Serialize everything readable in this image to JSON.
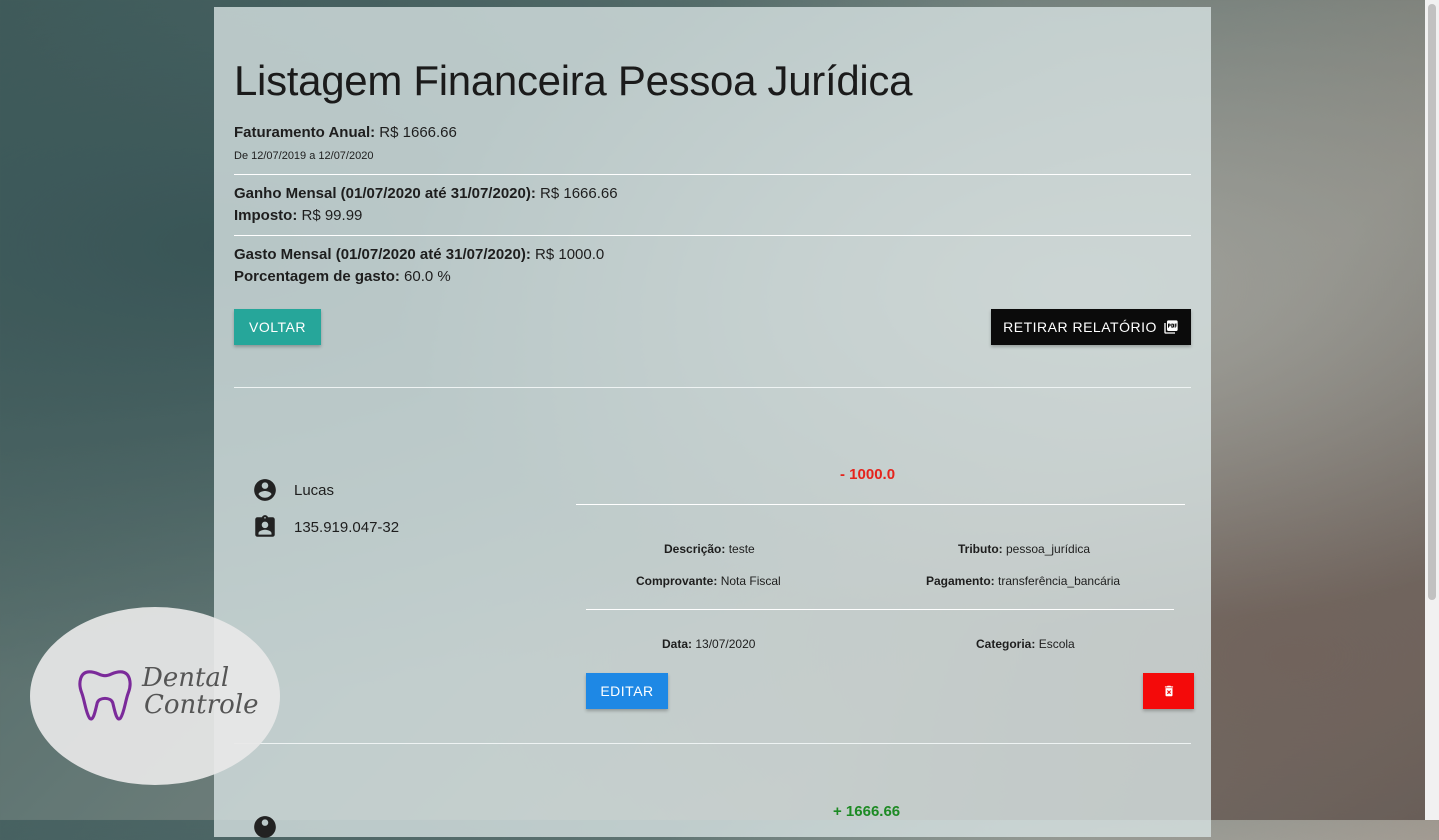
{
  "page": {
    "title": "Listagem Financeira Pessoa Jurídica"
  },
  "summary": {
    "annual_label": "Faturamento Anual:",
    "annual_value": "R$ 1666.66",
    "period_text": "De 12/07/2019 a 12/07/2020",
    "monthly_gain_label": "Ganho Mensal (01/07/2020 até 31/07/2020):",
    "monthly_gain_value": "R$ 1666.66",
    "tax_label": "Imposto:",
    "tax_value": "R$ 99.99",
    "monthly_spend_label": "Gasto Mensal (01/07/2020 até 31/07/2020):",
    "monthly_spend_value": "R$ 1000.0",
    "spend_pct_label": "Porcentagem de gasto:",
    "spend_pct_value": "60.0 %"
  },
  "actions": {
    "back_label": "VOLTAR",
    "report_label": "RETIRAR RELATÓRIO",
    "report_icon": "pdf-icon"
  },
  "entries": [
    {
      "name": "Lucas",
      "document": "135.919.047-32",
      "amount": "- 1000.0",
      "amount_color": "#e5231c",
      "description_label": "Descrição:",
      "description": "teste",
      "tax_type_label": "Tributo:",
      "tax_type": "pessoa_jurídica",
      "receipt_label": "Comprovante:",
      "receipt": "Nota Fiscal",
      "payment_label": "Pagamento:",
      "payment": "transferência_bancária",
      "date_label": "Data:",
      "date": "13/07/2020",
      "category_label": "Categoria:",
      "category": "Escola",
      "edit_label": "EDITAR",
      "delete_icon": "trash-icon"
    },
    {
      "amount": "+ 1666.66",
      "amount_color": "#1d8a23"
    }
  ],
  "logo": {
    "text_line1": "Dental",
    "text_line2": "Controle",
    "icon": "tooth-icon",
    "icon_color": "#7b2a9a"
  }
}
